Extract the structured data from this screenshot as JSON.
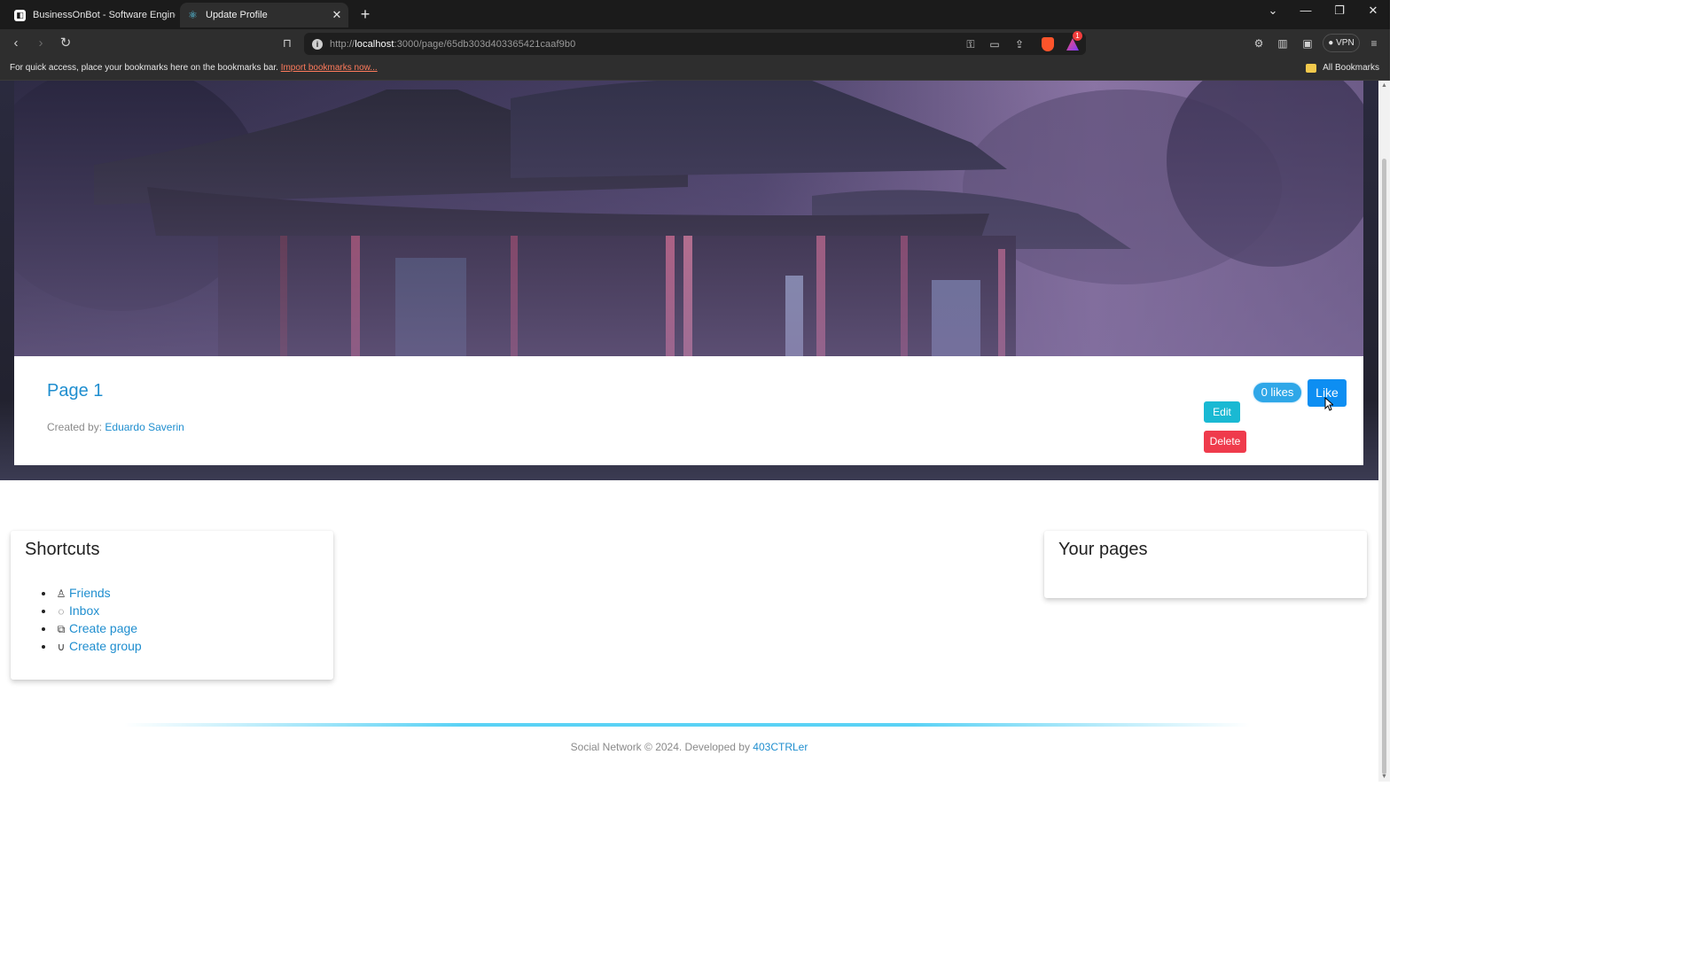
{
  "browser": {
    "tabs": [
      {
        "title": "BusinessOnBot - Software Engineeri",
        "favicon": "businessonbot-favicon",
        "active": false
      },
      {
        "title": "Update Profile",
        "favicon": "react-favicon",
        "active": true
      }
    ],
    "url_host": "localhost",
    "url_prefix": "http://",
    "url_rest": ":3000/page/65db303d403365421caaf9b0",
    "vpn_label": "VPN",
    "rewards_badge": "1",
    "bookmarks_message": "For quick access, place your bookmarks here on the bookmarks bar.",
    "bookmarks_import_link": "Import bookmarks now...",
    "all_bookmarks": "All Bookmarks"
  },
  "page": {
    "title": "Page 1",
    "created_by_label": "Created by:",
    "creator": "Eduardo Saverin",
    "likes_label": "0 likes",
    "like_button": "Like",
    "edit_button": "Edit",
    "delete_button": "Delete",
    "cover_image": "misty-pagoda-temple-illustration"
  },
  "shortcuts": {
    "title": "Shortcuts",
    "items": [
      {
        "label": "Friends",
        "icon": "person-icon"
      },
      {
        "label": "Inbox",
        "icon": "chat-icon"
      },
      {
        "label": "Create page",
        "icon": "copy-icon"
      },
      {
        "label": "Create group",
        "icon": "magnet-icon"
      }
    ]
  },
  "your_pages": {
    "title": "Your pages"
  },
  "footer": {
    "text": "Social Network © 2024. Developed by",
    "author": "403CTRLer"
  },
  "colors": {
    "link": "#1f8ecf",
    "like": "#0d8ef2",
    "edit": "#1ab9d3",
    "delete": "#ef3b4c",
    "accent_line": "#5ad2f5"
  }
}
